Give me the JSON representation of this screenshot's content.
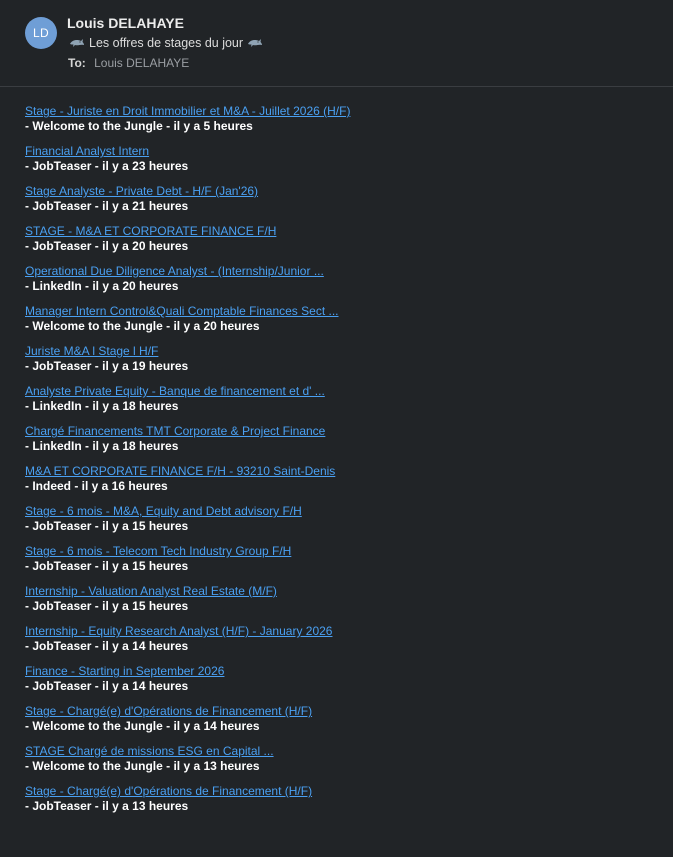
{
  "email": {
    "avatar_initials": "LD",
    "sender": "Louis DELAHAYE",
    "subject": "Les offres de stages du jour",
    "subject_icon": "dolphin-icon",
    "to_label": "To:",
    "to_value": "Louis DELAHAYE"
  },
  "colors": {
    "background": "#212427",
    "link": "#4aa0f2",
    "avatar": "#6f9ed6"
  },
  "jobs": [
    {
      "title": "Stage - Juriste en Droit Immobilier et M&A - Juillet 2026 (H/F)",
      "meta": "- Welcome to the Jungle - il y a 5 heures"
    },
    {
      "title": "Financial Analyst Intern",
      "meta": "- JobTeaser - il y a 23 heures"
    },
    {
      "title": "Stage Analyste - Private Debt - H/F (Jan'26)",
      "meta": "- JobTeaser - il y a 21 heures"
    },
    {
      "title": "STAGE - M&A ET CORPORATE FINANCE F/H",
      "meta": "- JobTeaser - il y a 20 heures"
    },
    {
      "title": "Operational Due Diligence Analyst - (Internship/Junior ...",
      "meta": "- LinkedIn - il y a 20 heures"
    },
    {
      "title": "Manager Intern Control&Quali Comptable Finances Sect ...",
      "meta": "- Welcome to the Jungle - il y a 20 heures"
    },
    {
      "title": "Juriste M&A l Stage l H/F",
      "meta": "- JobTeaser - il y a 19 heures"
    },
    {
      "title": "Analyste Private Equity - Banque de financement et d' ...",
      "meta": "- LinkedIn - il y a 18 heures"
    },
    {
      "title": "Chargé Financements TMT Corporate & Project Finance",
      "meta": "- LinkedIn - il y a 18 heures"
    },
    {
      "title": "M&A ET CORPORATE FINANCE F/H - 93210 Saint-Denis",
      "meta": "- Indeed - il y a 16 heures"
    },
    {
      "title": "Stage - 6 mois - M&A, Equity and Debt advisory F/H",
      "meta": "- JobTeaser - il y a 15 heures"
    },
    {
      "title": "Stage - 6 mois - Telecom Tech Industry Group F/H",
      "meta": "- JobTeaser - il y a 15 heures"
    },
    {
      "title": "Internship - Valuation Analyst Real Estate (M/F)",
      "meta": "- JobTeaser - il y a 15 heures"
    },
    {
      "title": "Internship - Equity Research Analyst (H/F) - January 2026",
      "meta": "- JobTeaser - il y a 14 heures"
    },
    {
      "title": "Finance - Starting in September 2026",
      "meta": "- JobTeaser - il y a 14 heures"
    },
    {
      "title": "Stage - Chargé(e) d'Opérations de Financement (H/F)",
      "meta": "- Welcome to the Jungle - il y a 14 heures"
    },
    {
      "title": "STAGE Chargé de missions ESG en Capital ...",
      "meta": "- Welcome to the Jungle - il y a 13 heures"
    },
    {
      "title": "Stage - Chargé(e) d'Opérations de Financement (H/F)",
      "meta": "- JobTeaser - il y a 13 heures"
    }
  ]
}
